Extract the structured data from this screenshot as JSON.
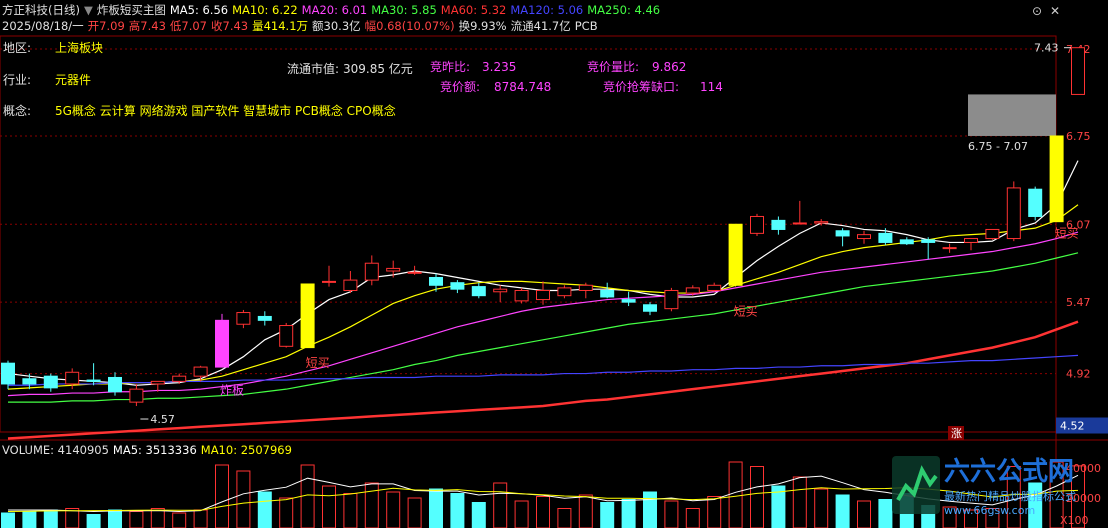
{
  "header": {
    "title_parts": [
      {
        "text": "方正科技(日线)",
        "color": "#e0e0e0"
      },
      {
        "text": "▼",
        "color": "#888"
      },
      {
        "text": "炸板短买主图",
        "color": "#e0e0e0"
      },
      {
        "text": "MA5: 6.56",
        "color": "#ffffff"
      },
      {
        "text": "MA10: 6.22",
        "color": "#ffff00"
      },
      {
        "text": "MA20: 6.01",
        "color": "#ff44ff"
      },
      {
        "text": "MA30: 5.85",
        "color": "#44ff44"
      },
      {
        "text": "MA60: 5.32",
        "color": "#ff3333"
      },
      {
        "text": "MA120: 5.06",
        "color": "#4444ff"
      },
      {
        "text": "MA250: 4.46",
        "color": "#44ff44"
      }
    ],
    "quote_parts": [
      {
        "text": "2025/08/18/一",
        "color": "#e0e0e0"
      },
      {
        "text": "开7.09",
        "color": "#ff4444"
      },
      {
        "text": "高7.43",
        "color": "#ff4444"
      },
      {
        "text": "低7.07",
        "color": "#ff4444"
      },
      {
        "text": "收7.43",
        "color": "#ff4444"
      },
      {
        "text": "量414.1万",
        "color": "#ffff00"
      },
      {
        "text": "额30.3亿",
        "color": "#e0e0e0"
      },
      {
        "text": "幅0.68(10.07%)",
        "color": "#ff4444"
      },
      {
        "text": "换9.93%",
        "color": "#e0e0e0"
      },
      {
        "text": "流通41.7亿",
        "color": "#e0e0e0"
      },
      {
        "text": "PCB",
        "color": "#e0e0e0"
      }
    ]
  },
  "stock_info": {
    "region_label": "地区:",
    "region_value": "上海板块",
    "industry_label": "行业:",
    "industry_value": "元器件",
    "concept_label": "概念:",
    "concept_value": "5G概念 云计算 网络游戏 国产软件 智慧城市 PCB概念 CPO概念",
    "float_cap_label": "流通市值:",
    "float_cap_value": "309.85 亿元",
    "auction_ratio_label": "竞昨比:",
    "auction_ratio_value": "3.235",
    "auction_amount_label": "竞价额:",
    "auction_amount_value": "8784.748",
    "auction_vol_ratio_label": "竞价量比:",
    "auction_vol_ratio_value": "9.862",
    "auction_gap_label": "竞价抢筹缺口:",
    "auction_gap_value": "114"
  },
  "price_axis": [
    "7.42",
    "6.75",
    "6.07",
    "5.47",
    "4.92"
  ],
  "current_price_tag": "4.52",
  "annotations": {
    "high_label": "7.43",
    "low_label": "4.57",
    "gap_label": "6.75 - 7.07",
    "zhaban": "炸板",
    "duanmai": "短买",
    "zhang": "涨"
  },
  "volume_header": [
    {
      "text": "VOLUME: 4140905",
      "color": "#e0e0e0"
    },
    {
      "text": "MA5: 3513336",
      "color": "#ffffff"
    },
    {
      "text": "MA10: 2507969",
      "color": "#ffff00"
    }
  ],
  "volume_axis": [
    "40000",
    "20000",
    "X100"
  ],
  "watermark": {
    "brand": "六六公式网",
    "slogan": "最新热门精品炒股指标公式",
    "url": "www.66gsw.com"
  },
  "colors": {
    "up": "#ff3232",
    "down": "#54ffff",
    "grid": "#8b0000",
    "zhaban_bar": "#ff44ff",
    "duanmai_bar": "#ffff00"
  },
  "chart_data": {
    "type": "candlestick",
    "price_ylim": [
      4.47,
      7.52
    ],
    "candles": [
      {
        "o": 5.0,
        "h": 5.02,
        "l": 4.8,
        "c": 4.84
      },
      {
        "o": 4.88,
        "h": 4.92,
        "l": 4.8,
        "c": 4.84
      },
      {
        "o": 4.9,
        "h": 4.92,
        "l": 4.78,
        "c": 4.81
      },
      {
        "o": 4.84,
        "h": 4.96,
        "l": 4.8,
        "c": 4.93
      },
      {
        "o": 4.87,
        "h": 5.0,
        "l": 4.83,
        "c": 4.86
      },
      {
        "o": 4.89,
        "h": 4.93,
        "l": 4.75,
        "c": 4.78
      },
      {
        "o": 4.7,
        "h": 4.84,
        "l": 4.67,
        "c": 4.8
      },
      {
        "o": 4.84,
        "h": 4.86,
        "l": 4.78,
        "c": 4.86
      },
      {
        "o": 4.86,
        "h": 4.92,
        "l": 4.84,
        "c": 4.9
      },
      {
        "o": 4.9,
        "h": 4.98,
        "l": 4.86,
        "c": 4.97
      },
      {
        "o": 4.97,
        "h": 5.38,
        "l": 4.97,
        "c": 5.33
      },
      {
        "o": 5.3,
        "h": 5.41,
        "l": 5.27,
        "c": 5.39
      },
      {
        "o": 5.36,
        "h": 5.4,
        "l": 5.29,
        "c": 5.33
      },
      {
        "o": 5.13,
        "h": 5.31,
        "l": 5.12,
        "c": 5.29
      },
      {
        "o": 5.12,
        "h": 5.61,
        "l": 5.12,
        "c": 5.61
      },
      {
        "o": 5.63,
        "h": 5.75,
        "l": 5.59,
        "c": 5.63
      },
      {
        "o": 5.56,
        "h": 5.71,
        "l": 5.54,
        "c": 5.64
      },
      {
        "o": 5.64,
        "h": 5.83,
        "l": 5.6,
        "c": 5.77
      },
      {
        "o": 5.71,
        "h": 5.79,
        "l": 5.66,
        "c": 5.73
      },
      {
        "o": 5.7,
        "h": 5.75,
        "l": 5.68,
        "c": 5.7
      },
      {
        "o": 5.66,
        "h": 5.69,
        "l": 5.55,
        "c": 5.6
      },
      {
        "o": 5.62,
        "h": 5.64,
        "l": 5.54,
        "c": 5.57
      },
      {
        "o": 5.59,
        "h": 5.62,
        "l": 5.5,
        "c": 5.52
      },
      {
        "o": 5.55,
        "h": 5.6,
        "l": 5.47,
        "c": 5.57
      },
      {
        "o": 5.48,
        "h": 5.58,
        "l": 5.46,
        "c": 5.56
      },
      {
        "o": 5.49,
        "h": 5.63,
        "l": 5.45,
        "c": 5.56
      },
      {
        "o": 5.52,
        "h": 5.6,
        "l": 5.5,
        "c": 5.58
      },
      {
        "o": 5.56,
        "h": 5.62,
        "l": 5.5,
        "c": 5.6
      },
      {
        "o": 5.56,
        "h": 5.62,
        "l": 5.5,
        "c": 5.51
      },
      {
        "o": 5.49,
        "h": 5.55,
        "l": 5.44,
        "c": 5.47
      },
      {
        "o": 5.45,
        "h": 5.47,
        "l": 5.37,
        "c": 5.4
      },
      {
        "o": 5.42,
        "h": 5.58,
        "l": 5.4,
        "c": 5.56
      },
      {
        "o": 5.54,
        "h": 5.6,
        "l": 5.52,
        "c": 5.58
      },
      {
        "o": 5.56,
        "h": 5.62,
        "l": 5.55,
        "c": 5.6
      },
      {
        "o": 5.6,
        "h": 6.07,
        "l": 5.59,
        "c": 6.07
      },
      {
        "o": 6.0,
        "h": 6.15,
        "l": 5.98,
        "c": 6.13
      },
      {
        "o": 6.1,
        "h": 6.13,
        "l": 5.99,
        "c": 6.03
      },
      {
        "o": 6.08,
        "h": 6.25,
        "l": 6.07,
        "c": 6.08
      },
      {
        "o": 6.08,
        "h": 6.11,
        "l": 6.06,
        "c": 6.09
      },
      {
        "o": 6.02,
        "h": 6.04,
        "l": 5.9,
        "c": 5.98
      },
      {
        "o": 5.96,
        "h": 6.02,
        "l": 5.92,
        "c": 5.99
      },
      {
        "o": 6.0,
        "h": 6.04,
        "l": 5.91,
        "c": 5.93
      },
      {
        "o": 5.95,
        "h": 5.97,
        "l": 5.91,
        "c": 5.92
      },
      {
        "o": 5.95,
        "h": 5.97,
        "l": 5.8,
        "c": 5.93
      },
      {
        "o": 5.89,
        "h": 5.92,
        "l": 5.85,
        "c": 5.89
      },
      {
        "o": 5.93,
        "h": 5.96,
        "l": 5.87,
        "c": 5.96
      },
      {
        "o": 5.96,
        "h": 6.03,
        "l": 5.95,
        "c": 6.03
      },
      {
        "o": 5.96,
        "h": 6.4,
        "l": 5.94,
        "c": 6.35
      },
      {
        "o": 6.34,
        "h": 6.36,
        "l": 6.1,
        "c": 6.13
      },
      {
        "o": 6.09,
        "h": 6.75,
        "l": 6.09,
        "c": 6.75
      },
      {
        "o": 7.07,
        "h": 7.43,
        "l": 7.07,
        "c": 7.43
      }
    ],
    "special_bars": [
      {
        "index": 10,
        "kind": "炸板"
      },
      {
        "index": 14,
        "kind": "短买"
      },
      {
        "index": 34,
        "kind": "短买"
      },
      {
        "index": 49,
        "kind": "短买"
      }
    ],
    "ma_lines": [
      {
        "name": "MA5",
        "color": "#ffffff",
        "values": [
          4.92,
          4.9,
          4.88,
          4.87,
          4.86,
          4.85,
          4.83,
          4.84,
          4.85,
          4.88,
          4.95,
          5.05,
          5.18,
          5.26,
          5.38,
          5.49,
          5.55,
          5.66,
          5.68,
          5.71,
          5.69,
          5.66,
          5.63,
          5.6,
          5.58,
          5.56,
          5.56,
          5.57,
          5.57,
          5.56,
          5.53,
          5.51,
          5.51,
          5.53,
          5.66,
          5.79,
          5.9,
          6.0,
          6.08,
          6.06,
          6.03,
          6.02,
          5.99,
          5.95,
          5.93,
          5.93,
          5.94,
          6.03,
          6.08,
          6.22,
          6.56
        ]
      },
      {
        "name": "MA10",
        "color": "#ffff00",
        "values": [
          4.8,
          4.81,
          4.82,
          4.83,
          4.84,
          4.84,
          4.85,
          4.85,
          4.86,
          4.87,
          4.9,
          4.95,
          5.0,
          5.05,
          5.13,
          5.2,
          5.28,
          5.37,
          5.46,
          5.52,
          5.57,
          5.6,
          5.62,
          5.63,
          5.63,
          5.62,
          5.61,
          5.6,
          5.58,
          5.56,
          5.55,
          5.54,
          5.54,
          5.55,
          5.6,
          5.65,
          5.7,
          5.76,
          5.82,
          5.86,
          5.89,
          5.91,
          5.93,
          5.95,
          5.98,
          5.99,
          6.0,
          6.02,
          6.04,
          6.1,
          6.22
        ]
      },
      {
        "name": "MA20",
        "color": "#ff44ff",
        "values": [
          4.75,
          4.76,
          4.76,
          4.77,
          4.77,
          4.78,
          4.78,
          4.79,
          4.79,
          4.8,
          4.82,
          4.84,
          4.87,
          4.9,
          4.94,
          4.98,
          5.03,
          5.08,
          5.13,
          5.18,
          5.23,
          5.28,
          5.32,
          5.36,
          5.4,
          5.43,
          5.45,
          5.47,
          5.49,
          5.5,
          5.51,
          5.52,
          5.53,
          5.55,
          5.58,
          5.61,
          5.64,
          5.67,
          5.7,
          5.72,
          5.74,
          5.76,
          5.78,
          5.8,
          5.82,
          5.84,
          5.86,
          5.89,
          5.92,
          5.96,
          6.01
        ]
      },
      {
        "name": "MA30",
        "color": "#44ff44",
        "values": [
          4.7,
          4.7,
          4.7,
          4.71,
          4.71,
          4.72,
          4.72,
          4.73,
          4.73,
          4.74,
          4.75,
          4.76,
          4.78,
          4.8,
          4.83,
          4.86,
          4.89,
          4.92,
          4.95,
          4.99,
          5.02,
          5.06,
          5.09,
          5.12,
          5.15,
          5.18,
          5.21,
          5.24,
          5.27,
          5.3,
          5.32,
          5.34,
          5.36,
          5.38,
          5.41,
          5.44,
          5.47,
          5.5,
          5.53,
          5.56,
          5.59,
          5.61,
          5.63,
          5.65,
          5.67,
          5.69,
          5.71,
          5.74,
          5.77,
          5.81,
          5.85
        ]
      },
      {
        "name": "MA60",
        "color": "#ff3333",
        "values": [
          4.42,
          4.43,
          4.44,
          4.45,
          4.46,
          4.47,
          4.48,
          4.49,
          4.5,
          4.51,
          4.52,
          4.53,
          4.54,
          4.55,
          4.56,
          4.57,
          4.58,
          4.59,
          4.6,
          4.61,
          4.62,
          4.63,
          4.64,
          4.65,
          4.66,
          4.67,
          4.69,
          4.71,
          4.72,
          4.74,
          4.76,
          4.78,
          4.8,
          4.82,
          4.84,
          4.86,
          4.88,
          4.9,
          4.92,
          4.94,
          4.96,
          4.98,
          5.0,
          5.03,
          5.06,
          5.09,
          5.12,
          5.16,
          5.2,
          5.26,
          5.32
        ]
      },
      {
        "name": "MA120",
        "color": "#4444ff",
        "values": [
          4.83,
          4.83,
          4.84,
          4.84,
          4.84,
          4.85,
          4.85,
          4.85,
          4.86,
          4.86,
          4.86,
          4.87,
          4.87,
          4.87,
          4.88,
          4.88,
          4.88,
          4.89,
          4.89,
          4.89,
          4.9,
          4.9,
          4.9,
          4.91,
          4.91,
          4.91,
          4.92,
          4.92,
          4.93,
          4.93,
          4.94,
          4.94,
          4.95,
          4.95,
          4.96,
          4.96,
          4.97,
          4.97,
          4.98,
          4.98,
          4.99,
          4.99,
          5.0,
          5.0,
          5.01,
          5.02,
          5.02,
          5.03,
          5.04,
          5.05,
          5.06
        ]
      }
    ],
    "volume": {
      "unit": "X100",
      "ylim": [
        0,
        48000
      ],
      "values": [
        10000,
        11000,
        12000,
        13000,
        9000,
        12000,
        11000,
        13000,
        10000,
        12000,
        42000,
        38000,
        24000,
        20000,
        42000,
        28000,
        23000,
        30000,
        24000,
        20000,
        26000,
        23000,
        17000,
        30000,
        18000,
        21000,
        13000,
        22000,
        17000,
        19000,
        24000,
        18000,
        13000,
        21000,
        44000,
        41000,
        28000,
        34000,
        26000,
        22000,
        18000,
        19000,
        23000,
        15000,
        14000,
        12000,
        13000,
        41000,
        30000,
        44000,
        41409
      ],
      "ma5": [
        12000,
        12000,
        12000,
        11500,
        11000,
        11400,
        11400,
        11600,
        11000,
        11600,
        17400,
        22800,
        25200,
        27200,
        33200,
        30400,
        27400,
        29400,
        29400,
        25000,
        24600,
        24600,
        22000,
        23200,
        22800,
        21800,
        19800,
        20800,
        18200,
        18400,
        19000,
        20000,
        18200,
        19000,
        23800,
        27400,
        29400,
        33600,
        34600,
        30200,
        25600,
        23800,
        21600,
        19400,
        17800,
        16600,
        15400,
        19000,
        22000,
        28000,
        35133
      ],
      "ma10": [
        11000,
        11200,
        11400,
        11500,
        11600,
        11700,
        11800,
        11900,
        11800,
        11800,
        14400,
        16600,
        17800,
        18900,
        22100,
        21500,
        22700,
        24600,
        26500,
        25400,
        25100,
        25600,
        24300,
        24200,
        22800,
        22200,
        21300,
        20900,
        19800,
        19800,
        19600,
        19300,
        18900,
        19500,
        21200,
        23100,
        24000,
        25600,
        26800,
        26000,
        26200,
        26300,
        26900,
        25900,
        24600,
        22600,
        20700,
        22400,
        22400,
        24600,
        25080
      ]
    }
  }
}
